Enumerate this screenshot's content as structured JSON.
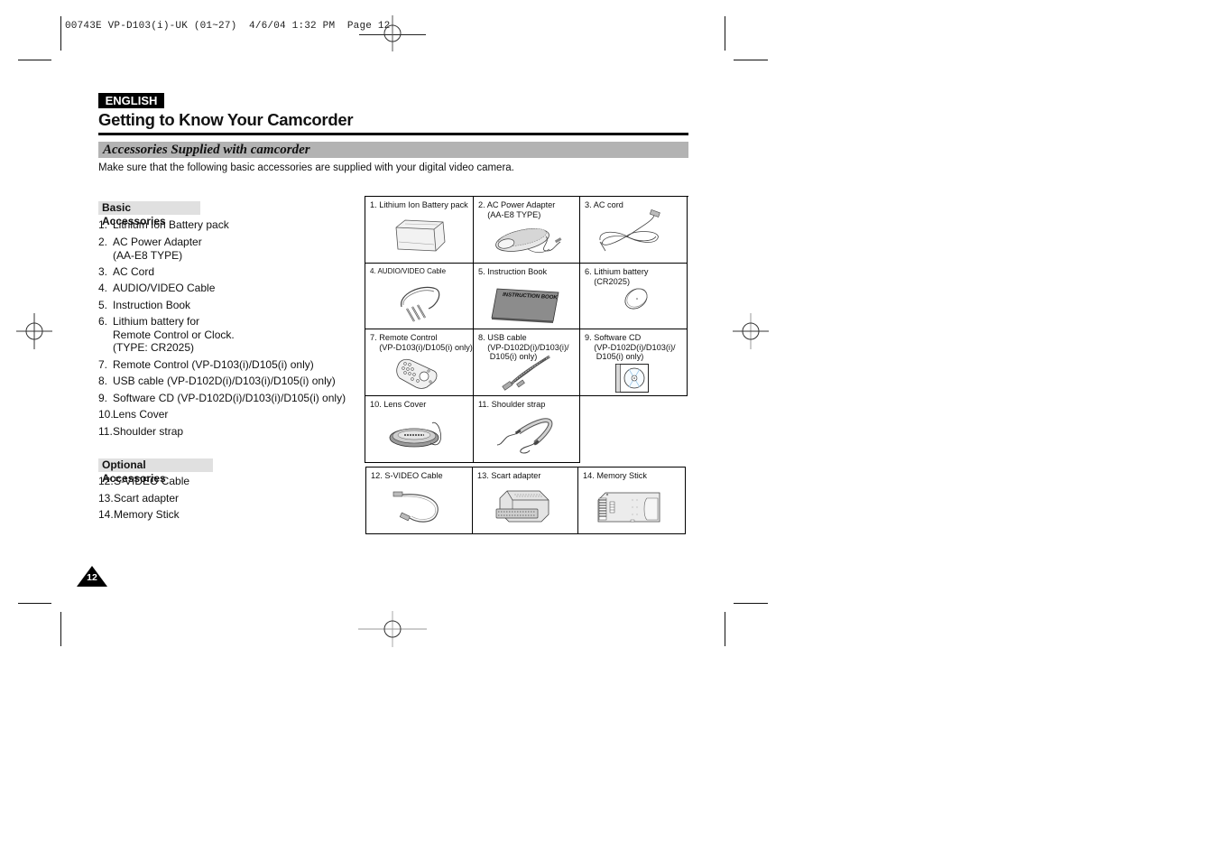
{
  "slug": {
    "text": "00743E VP-D103(i)-UK (01~27)  4/6/04 1:32 PM  Page 12"
  },
  "header": {
    "language_badge": "ENGLISH",
    "page_title": "Getting to Know Your Camcorder",
    "section_title": "Accessories Supplied with camcorder",
    "intro": "Make sure that the following basic accessories are supplied with your digital video camera."
  },
  "basic": {
    "heading": "Basic Accessories",
    "items": [
      {
        "num": "1.",
        "lines": [
          "Lithium Ion Battery pack"
        ]
      },
      {
        "num": "2.",
        "lines": [
          "AC Power Adapter",
          "(AA-E8 TYPE)"
        ]
      },
      {
        "num": "3.",
        "lines": [
          "AC Cord"
        ]
      },
      {
        "num": "4.",
        "lines": [
          "AUDIO/VIDEO Cable"
        ]
      },
      {
        "num": "5.",
        "lines": [
          "Instruction Book"
        ]
      },
      {
        "num": "6.",
        "lines": [
          "Lithium battery for",
          "Remote Control or Clock.",
          "(TYPE: CR2025)"
        ]
      },
      {
        "num": "7.",
        "lines": [
          "Remote Control (VP-D103(i)/D105(i) only)"
        ]
      },
      {
        "num": "8.",
        "lines": [
          "USB cable (VP-D102D(i)/D103(i)/D105(i) only)"
        ]
      },
      {
        "num": "9.",
        "lines": [
          "Software CD (VP-D102D(i)/D103(i)/D105(i) only)"
        ]
      },
      {
        "num": "10.",
        "lines": [
          "Lens Cover"
        ]
      },
      {
        "num": "11.",
        "lines": [
          "Shoulder strap"
        ]
      }
    ]
  },
  "optional": {
    "heading": "Optional Accessories",
    "items": [
      {
        "num": "12.",
        "lines": [
          "S-VIDEO Cable"
        ]
      },
      {
        "num": "13.",
        "lines": [
          "Scart adapter"
        ]
      },
      {
        "num": "14.",
        "lines": [
          "Memory Stick"
        ]
      }
    ]
  },
  "grid": {
    "cells": [
      {
        "label": "1. Lithium Ion Battery pack",
        "icon": "battery-pack-icon"
      },
      {
        "label": "2. AC Power Adapter\n    (AA-E8 TYPE)",
        "icon": "ac-adapter-icon"
      },
      {
        "label": "3. AC cord",
        "icon": "ac-cord-icon"
      },
      {
        "label": "4. AUDIO/VIDEO Cable",
        "icon": "av-cable-icon"
      },
      {
        "label": "5. Instruction Book",
        "icon": "instruction-book-icon",
        "book_text": "INSTRUCTION BOOK"
      },
      {
        "label": "6. Lithium battery\n    (CR2025)",
        "icon": "coin-battery-icon"
      },
      {
        "label": "7. Remote Control\n    (VP-D103(i)/D105(i) only)",
        "icon": "remote-control-icon"
      },
      {
        "label": "8. USB cable\n    (VP-D102D(i)/D103(i)/\n     D105(i) only)",
        "icon": "usb-cable-icon"
      },
      {
        "label": "9. Software CD\n    (VP-D102D(i)/D103(i)/\n     D105(i) only)",
        "icon": "software-cd-icon"
      },
      {
        "label": "10. Lens Cover",
        "icon": "lens-cover-icon"
      },
      {
        "label": "11. Shoulder strap",
        "icon": "shoulder-strap-icon"
      }
    ],
    "optional_cells": [
      {
        "label": "12. S-VIDEO Cable",
        "icon": "s-video-cable-icon"
      },
      {
        "label": "13. Scart adapter",
        "icon": "scart-adapter-icon"
      },
      {
        "label": "14. Memory Stick",
        "icon": "memory-stick-icon"
      }
    ]
  },
  "footer": {
    "page_number": "12"
  }
}
